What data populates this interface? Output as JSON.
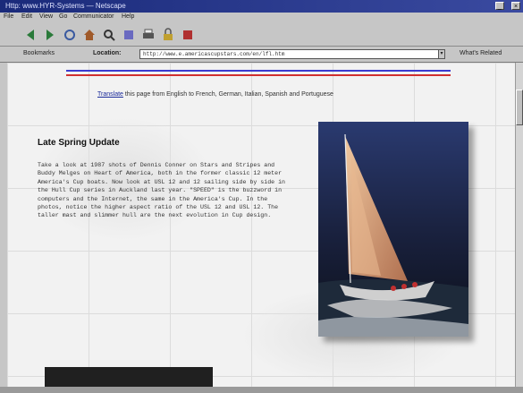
{
  "window": {
    "title": "Http: www.HYR-Systems — Netscape"
  },
  "menu": {
    "items": [
      "File",
      "Edit",
      "View",
      "Go",
      "Communicator",
      "Help"
    ]
  },
  "toolbar": {
    "buttons": [
      "back-icon",
      "forward-icon",
      "reload-icon",
      "home-icon",
      "search-icon",
      "guide-icon",
      "print-icon",
      "security-icon",
      "stop-icon"
    ]
  },
  "location": {
    "bookmarks_label": "Bookmarks",
    "location_label": "Location:",
    "url": "http://www.e.americascupstars.com/en/lfl.htm",
    "related_label": "What's Related"
  },
  "page": {
    "translate_link": "Translate",
    "translate_rest": " this page from English to French, German, Italian, Spanish and Portuguese",
    "heading": "Late Spring Update",
    "body": "Take a look at 1987 shots of Dennis Conner on Stars and Stripes and Buddy Melges on Heart of America, both in the former classic 12 meter America's Cup boats. Now look at USL 12 and 12 sailing side by side in the Hull Cup series in Auckland last year. \"SPEED\" is the buzzword in computers and the Internet, the same in the America's Cup. In the photos, notice the higher aspect ratio of the USL 12 and USL 12. The taller mast and slimmer hull are the next evolution in Cup design.",
    "photo": "sailboat-photo"
  }
}
